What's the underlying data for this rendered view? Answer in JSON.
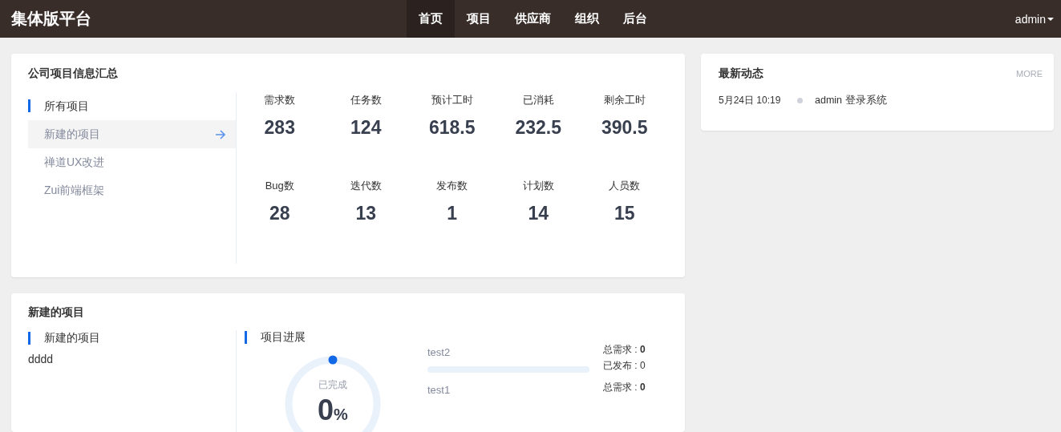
{
  "navbar": {
    "brand": "集体版平台",
    "items": [
      {
        "label": "首页",
        "selected": true
      },
      {
        "label": "项目",
        "selected": false
      },
      {
        "label": "供应商",
        "selected": false
      },
      {
        "label": "组织",
        "selected": false
      },
      {
        "label": "后台",
        "selected": false
      }
    ],
    "user": "admin"
  },
  "summary": {
    "title": "公司项目信息汇总",
    "projects": [
      {
        "label": "所有项目",
        "selected": true,
        "hovered": false
      },
      {
        "label": "新建的项目",
        "selected": false,
        "hovered": true
      },
      {
        "label": "禅道UX改进",
        "selected": false,
        "hovered": false
      },
      {
        "label": "Zui前端框架",
        "selected": false,
        "hovered": false
      }
    ],
    "stats": [
      {
        "label": "需求数",
        "value": "283"
      },
      {
        "label": "任务数",
        "value": "124"
      },
      {
        "label": "预计工时",
        "value": "618.5"
      },
      {
        "label": "已消耗",
        "value": "232.5"
      },
      {
        "label": "剩余工时",
        "value": "390.5"
      },
      {
        "label": "Bug数",
        "value": "28"
      },
      {
        "label": "迭代数",
        "value": "13"
      },
      {
        "label": "发布数",
        "value": "1"
      },
      {
        "label": "计划数",
        "value": "14"
      },
      {
        "label": "人员数",
        "value": "15"
      }
    ]
  },
  "project": {
    "title": "新建的项目",
    "name_heading": "新建的项目",
    "description": "dddd",
    "progress_heading": "项目进展",
    "completion": {
      "label": "已完成",
      "value": "0",
      "unit": "%"
    },
    "items": [
      {
        "name": "test2",
        "level": 0,
        "total": "总需求 : **0**",
        "released": "已发布 : 0"
      },
      {
        "name": "test1",
        "total": "总需求 : **0**"
      }
    ]
  },
  "activity": {
    "title": "最新动态",
    "more": "MORE",
    "entries": [
      {
        "time": "5月24日 10:19",
        "text": "admin 登录系统"
      }
    ]
  }
}
